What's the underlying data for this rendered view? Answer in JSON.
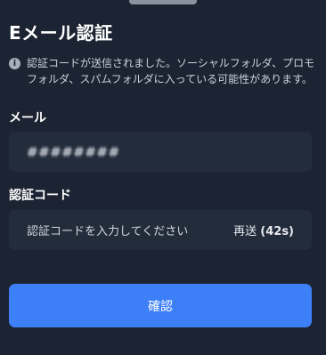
{
  "sheet": {
    "title": "Eメール認証",
    "info_text": "認証コードが送信されました。ソーシャルフォルダ、プロモフォルダ、スパムフォルダに入っている可能性があります。"
  },
  "email": {
    "label": "メール",
    "masked_value": "########"
  },
  "code": {
    "label": "認証コード",
    "placeholder": "認証コードを入力してください",
    "resend_label": "再送",
    "resend_countdown": "(42s)"
  },
  "confirm_button": "確認",
  "colors": {
    "background": "#1c2433",
    "field": "#232c3b",
    "accent": "#3d7ff7"
  },
  "icons": {
    "info": "info-icon"
  }
}
